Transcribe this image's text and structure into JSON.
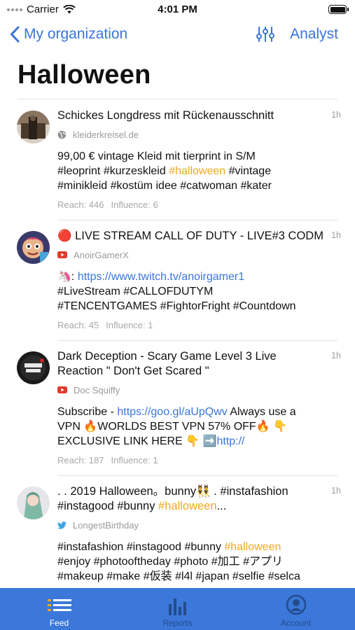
{
  "status_bar": {
    "carrier": "Carrier",
    "time": "4:01 PM"
  },
  "nav": {
    "back_label": "My organization",
    "right_label": "Analyst"
  },
  "page": {
    "title": "Halloween"
  },
  "posts": [
    {
      "title": "Schickes Longdress mit Rückenausschnitt",
      "time": "1h",
      "source": "kleiderkreisel.de",
      "source_icon": "globe-icon",
      "body": [
        {
          "t": "99,00 € vintage Kleid mit tierprint in S/M\n#leoprint #kurzeskleid "
        },
        {
          "t": "#halloween",
          "k": "hl"
        },
        {
          "t": " #vintage\n#minikleid #kostüm idee #catwoman #kater"
        }
      ],
      "reach": "Reach: 446",
      "influence": "Influence: 6"
    },
    {
      "title": "🔴 LIVE STREAM CALL OF DUTY - LIVE#3 CODM",
      "time": "1h",
      "source": "AnoirGamerX",
      "source_icon": "youtube-icon",
      "body": [
        {
          "t": "🦄: "
        },
        {
          "t": "https://www.twitch.tv/anoirgamer1",
          "k": "link"
        },
        {
          "t": "\n#LiveStream #CALLOFDUTYM\n#TENCENTGAMES #FightorFright #Countdown"
        }
      ],
      "reach": "Reach: 45",
      "influence": "Influence: 1"
    },
    {
      "title": "Dark Deception - Scary Game Level 3 Live Reaction  \" Don't Get Scared \"",
      "time": "1h",
      "source": "Doc Squiffy",
      "source_icon": "youtube-icon",
      "body": [
        {
          "t": "Subscribe - "
        },
        {
          "t": "https://goo.gl/aUpQwv",
          "k": "link"
        },
        {
          "t": " Always use a\nVPN 🔥WORLDS BEST VPN 57% OFF🔥 👇\nEXCLUSIVE LINK HERE 👇 ➡️"
        },
        {
          "t": "http://",
          "k": "link"
        }
      ],
      "reach": "Reach: 187",
      "influence": "Influence: 1"
    },
    {
      "title_parts": [
        {
          "t": ". . 2019 Halloween。bunny👯 . #instafashion\n#instagood #bunny "
        },
        {
          "t": "#halloween",
          "k": "hl"
        },
        {
          "t": "..."
        }
      ],
      "time": "1h",
      "source": "LongestBirthday",
      "source_icon": "twitter-icon",
      "body": [
        {
          "t": "#instafashion #instagood #bunny "
        },
        {
          "t": "#halloween",
          "k": "hl"
        },
        {
          "t": "\n#enjoy #photooftheday #photo #加工 #アプリ\n#makeup #make #仮装 #l4l #japan #selfie #selca"
        }
      ],
      "reach": "",
      "influence": ""
    }
  ],
  "tabs": [
    {
      "label": "Feed",
      "icon": "feed-icon",
      "active": true
    },
    {
      "label": "Reports",
      "icon": "bar-chart-icon",
      "active": false
    },
    {
      "label": "Account",
      "icon": "account-icon",
      "active": false
    }
  ],
  "colors": {
    "accent": "#3b74d9",
    "highlight": "#f2a626",
    "tab_bar": "#3b78d9"
  }
}
